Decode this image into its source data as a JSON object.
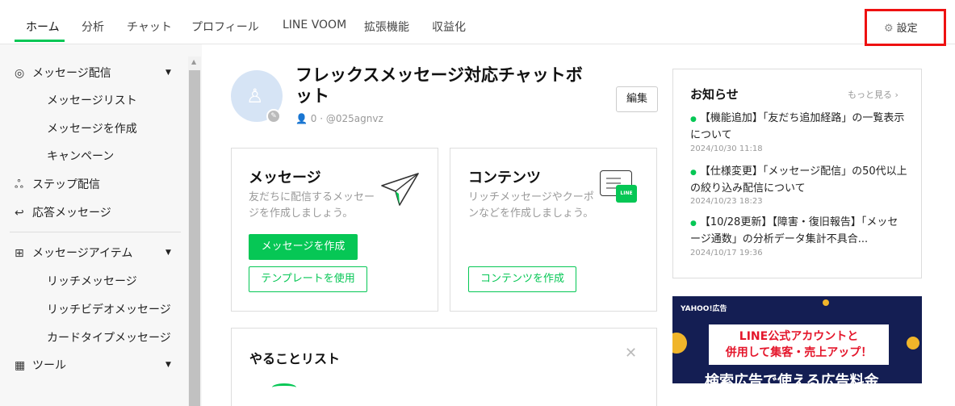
{
  "nav": {
    "items": [
      "ホーム",
      "分析",
      "チャット",
      "プロフィール",
      "LINE VOOM",
      "拡張機能",
      "収益化"
    ],
    "settings_label": "設定"
  },
  "sidebar": {
    "sections": [
      {
        "label": "メッセージ配信",
        "icon": "broadcast-icon",
        "sub": [
          "メッセージリスト",
          "メッセージを作成",
          "キャンペーン"
        ]
      },
      {
        "label": "ステップ配信",
        "icon": "step-icon"
      },
      {
        "label": "応答メッセージ",
        "icon": "reply-icon"
      },
      {
        "label": "メッセージアイテム",
        "icon": "plus-box-icon",
        "sub": [
          "リッチメッセージ",
          "リッチビデオメッセージ",
          "カードタイプメッセージ"
        ]
      },
      {
        "label": "ツール",
        "icon": "shop-icon"
      }
    ]
  },
  "profile": {
    "name": "フレックスメッセージ対応チャットボット",
    "friends": "0",
    "id": "@025agnvz",
    "edit_label": "編集"
  },
  "message_card": {
    "title": "メッセージ",
    "desc": "友だちに配信するメッセージを作成しましょう。",
    "create_label": "メッセージを作成",
    "template_label": "テンプレートを使用"
  },
  "content_card": {
    "title": "コンテンツ",
    "desc": "リッチメッセージやクーポンなどを作成しましょう。",
    "create_label": "コンテンツを作成",
    "badge": "LINE"
  },
  "todo": {
    "title": "やることリスト"
  },
  "news": {
    "title": "お知らせ",
    "more": "もっと見る",
    "items": [
      {
        "text": "【機能追加】「友だち追加経路」の一覧表示について",
        "date": "2024/10/30 11:18"
      },
      {
        "text": "【仕様変更】「メッセージ配信」の50代以上の絞り込み配信について",
        "date": "2024/10/23 18:23"
      },
      {
        "text": "【10/28更新】【障害・復旧報告】「メッセージ通数」の分析データ集計不具合...",
        "date": "2024/10/17 19:36"
      }
    ]
  },
  "ad": {
    "logo": "YAHOO!広告",
    "line1": "LINE公式アカウントと",
    "line2": "併用して集客・売上アップ！",
    "bottom": "検索広告で使える広告料金"
  },
  "colors": {
    "accent": "#06c755",
    "highlight": "#ee1111"
  }
}
